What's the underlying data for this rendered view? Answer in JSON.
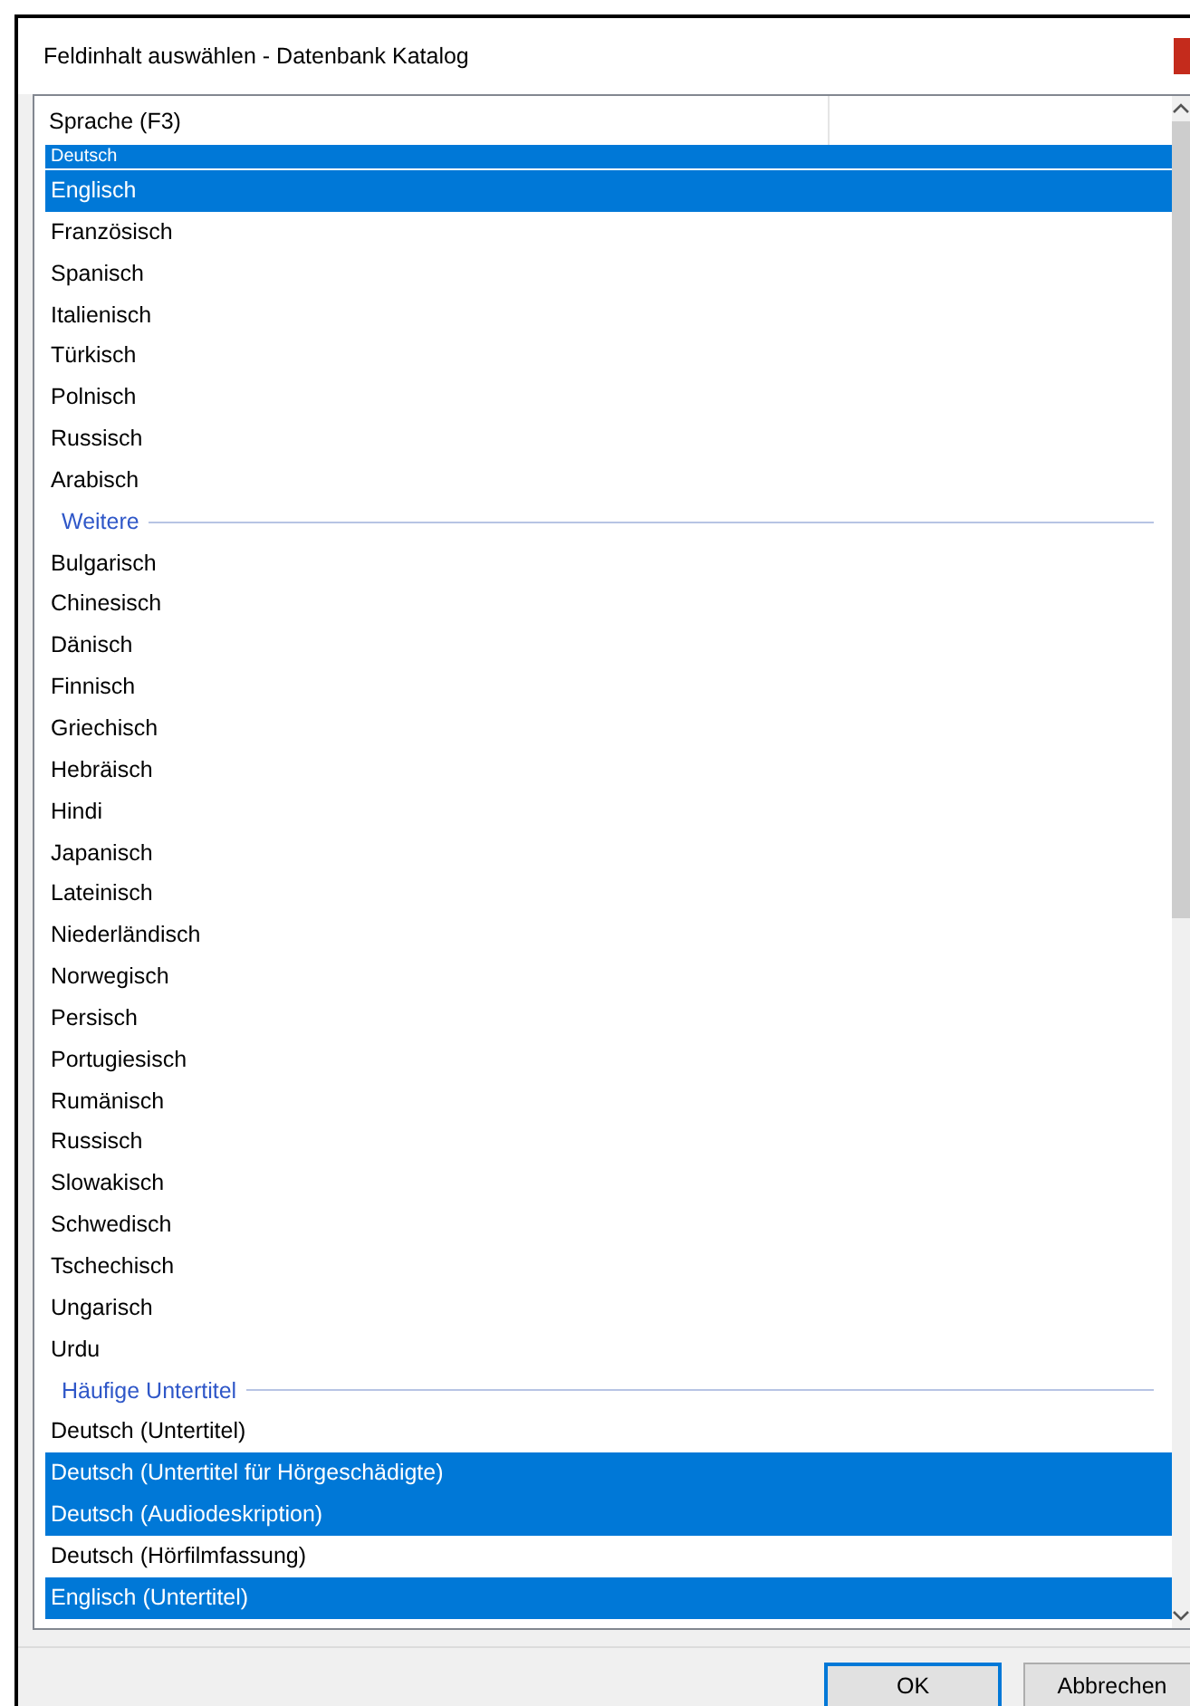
{
  "window": {
    "title": "Feldinhalt auswählen - Datenbank Katalog"
  },
  "list": {
    "columns": [
      "Sprache (F3)"
    ],
    "items": [
      {
        "kind": "partial",
        "label": "Deutsch",
        "selected": true
      },
      {
        "kind": "item",
        "label": "Englisch",
        "selected": true
      },
      {
        "kind": "item",
        "label": "Französisch",
        "selected": false
      },
      {
        "kind": "item",
        "label": "Spanisch",
        "selected": false
      },
      {
        "kind": "item",
        "label": "Italienisch",
        "selected": false
      },
      {
        "kind": "item",
        "label": "Türkisch",
        "selected": false
      },
      {
        "kind": "item",
        "label": "Polnisch",
        "selected": false
      },
      {
        "kind": "item",
        "label": "Russisch",
        "selected": false
      },
      {
        "kind": "item",
        "label": "Arabisch",
        "selected": false
      },
      {
        "kind": "heading",
        "label": "Weitere"
      },
      {
        "kind": "item",
        "label": "Bulgarisch",
        "selected": false
      },
      {
        "kind": "item",
        "label": "Chinesisch",
        "selected": false
      },
      {
        "kind": "item",
        "label": "Dänisch",
        "selected": false
      },
      {
        "kind": "item",
        "label": "Finnisch",
        "selected": false
      },
      {
        "kind": "item",
        "label": "Griechisch",
        "selected": false
      },
      {
        "kind": "item",
        "label": "Hebräisch",
        "selected": false
      },
      {
        "kind": "item",
        "label": "Hindi",
        "selected": false
      },
      {
        "kind": "item",
        "label": "Japanisch",
        "selected": false
      },
      {
        "kind": "item",
        "label": "Lateinisch",
        "selected": false
      },
      {
        "kind": "item",
        "label": "Niederländisch",
        "selected": false
      },
      {
        "kind": "item",
        "label": "Norwegisch",
        "selected": false
      },
      {
        "kind": "item",
        "label": "Persisch",
        "selected": false
      },
      {
        "kind": "item",
        "label": "Portugiesisch",
        "selected": false
      },
      {
        "kind": "item",
        "label": "Rumänisch",
        "selected": false
      },
      {
        "kind": "item",
        "label": "Russisch",
        "selected": false
      },
      {
        "kind": "item",
        "label": "Slowakisch",
        "selected": false
      },
      {
        "kind": "item",
        "label": "Schwedisch",
        "selected": false
      },
      {
        "kind": "item",
        "label": "Tschechisch",
        "selected": false
      },
      {
        "kind": "item",
        "label": "Ungarisch",
        "selected": false
      },
      {
        "kind": "item",
        "label": "Urdu",
        "selected": false
      },
      {
        "kind": "heading",
        "label": "Häufige Untertitel"
      },
      {
        "kind": "item",
        "label": "Deutsch (Untertitel)",
        "selected": false
      },
      {
        "kind": "item",
        "label": "Deutsch (Untertitel für Hörgeschädigte)",
        "selected": true
      },
      {
        "kind": "item",
        "label": "Deutsch (Audiodeskription)",
        "selected": true
      },
      {
        "kind": "item",
        "label": "Deutsch (Hörfilmfassung)",
        "selected": false
      },
      {
        "kind": "item",
        "label": "Englisch (Untertitel)",
        "selected": true
      }
    ]
  },
  "buttons": [
    "OK",
    "Abbrechen"
  ]
}
